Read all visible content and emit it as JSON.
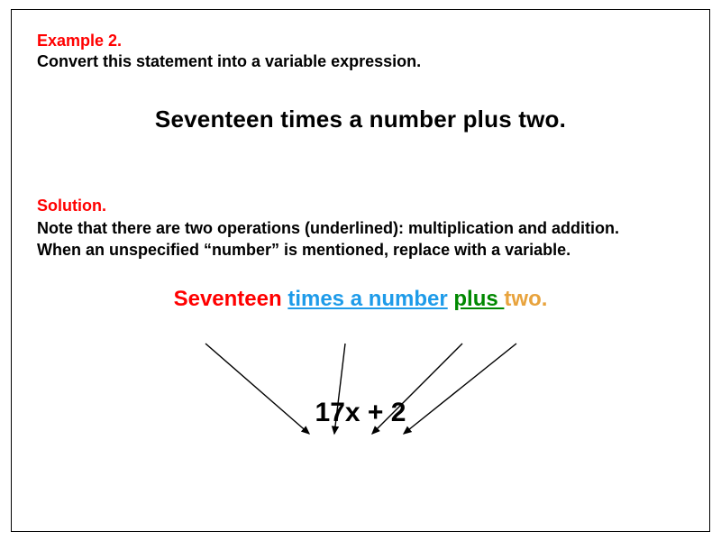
{
  "example": {
    "label": "Example 2.",
    "prompt": "Convert this statement into a variable expression.",
    "statement": "Seventeen times a number plus two."
  },
  "solution": {
    "label": "Solution.",
    "text": "Note that there are two operations (underlined): multiplication and addition. When an unspecified “number” is mentioned, replace with a variable.",
    "colored": {
      "part1": "Seventeen",
      "part2": "times a number",
      "part3": "plus ",
      "part4": "two."
    },
    "expression": "17x + 2"
  }
}
